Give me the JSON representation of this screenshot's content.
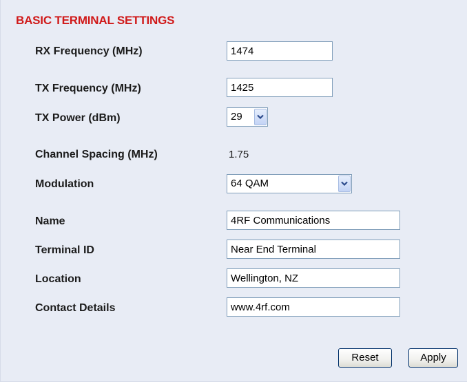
{
  "section_title": "BASIC TERMINAL SETTINGS",
  "fields": {
    "rx_frequency": {
      "label": "RX Frequency (MHz)",
      "value": "1474"
    },
    "tx_frequency": {
      "label": "TX Frequency (MHz)",
      "value": "1425"
    },
    "tx_power": {
      "label": "TX Power (dBm)",
      "selected": "29"
    },
    "channel_spacing": {
      "label": "Channel Spacing (MHz)",
      "value": "1.75"
    },
    "modulation": {
      "label": "Modulation",
      "selected": "64 QAM"
    },
    "name": {
      "label": "Name",
      "value": "4RF Communications"
    },
    "terminal_id": {
      "label": "Terminal ID",
      "value": "Near End Terminal"
    },
    "location": {
      "label": "Location",
      "value": "Wellington, NZ"
    },
    "contact_details": {
      "label": "Contact Details",
      "value": "www.4rf.com"
    }
  },
  "buttons": {
    "reset": "Reset",
    "apply": "Apply"
  },
  "colors": {
    "title": "#d01a1a",
    "panel_background": "#e8ecf5",
    "input_border": "#7f9db9"
  },
  "icons": {
    "dropdown": "chevron-down-icon"
  }
}
